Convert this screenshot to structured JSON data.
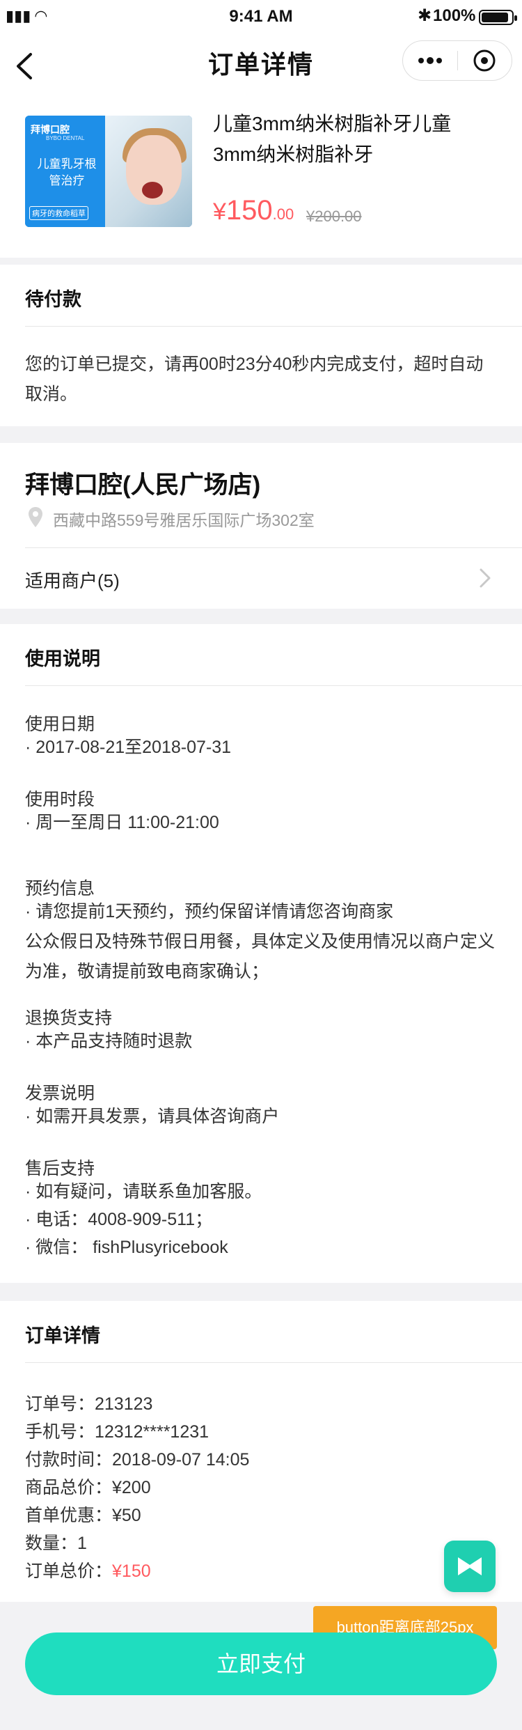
{
  "status_bar": {
    "time": "9:41 AM",
    "battery": "100%"
  },
  "navbar": {
    "title": "订单详情"
  },
  "product": {
    "name": "儿童3mm纳米树脂补牙儿童3mm纳米树脂补牙",
    "currency": "¥",
    "price_int": "150",
    "price_dec": ".00",
    "original_price": "¥200.00",
    "thumb": {
      "brand": "拜博口腔",
      "brand_en": "BYBO DENTAL",
      "slogan": "儿童乳牙根管治疗",
      "subtitle": "病牙的救命稻草"
    }
  },
  "pending": {
    "title": "待付款",
    "message": "您的订单已提交，请再00时23分40秒内完成支付，超时自动取消。"
  },
  "shop": {
    "name": "拜博口腔(人民广场店)",
    "address": "西藏中路559号雅居乐国际广场302室",
    "merchants_label": "适用商户(5)"
  },
  "usage": {
    "title": "使用说明",
    "date_head": "使用日期",
    "date_value": "· 2017-08-21至2018-07-31",
    "time_head": "使用时段",
    "time_value": "· 周一至周日 11:00-21:00",
    "booking_head": "预约信息",
    "booking_1": "· 请您提前1天预约，预约保留详情请您咨询商家",
    "booking_2": "公众假日及特殊节假日用餐，具体定义及使用情况以商户定义为准，敬请提前致电商家确认；",
    "refund_head": "退换货支持",
    "refund_value": "· 本产品支持随时退款",
    "invoice_head": "发票说明",
    "invoice_value": "· 如需开具发票，请具体咨询商户",
    "after_head": "售后支持",
    "after_1": "· 如有疑问，请联系鱼加客服。",
    "after_2": "· 电话：4008-909-511；",
    "after_3": "· 微信： fishPlusyricebook"
  },
  "order": {
    "title": "订单详情",
    "order_no": "订单号：213123",
    "phone": "手机号：12312****1231",
    "pay_time": "付款时间：2018-09-07 14:05",
    "goods_total": "商品总价：¥200",
    "first_discount": "首单优惠：¥50",
    "quantity": "数量：1",
    "total_label": "订单总价：",
    "total_value": "¥150"
  },
  "tooltip": "button距离底部25px",
  "pay_button": "立即支付",
  "colors": {
    "accent": "#1fddbf",
    "price_red": "#ff5a5f",
    "tooltip": "#f5a623"
  }
}
